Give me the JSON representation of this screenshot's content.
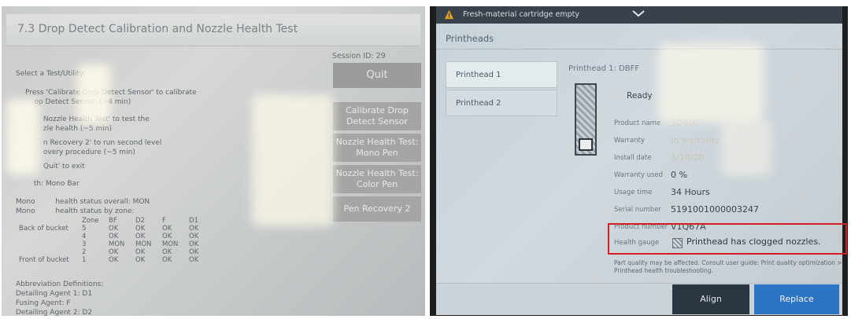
{
  "left": {
    "title": "7.3 Drop Detect Calibration and Nozzle Health Test",
    "session": "Session ID: 29",
    "select_label": "Select a Test/Utility:",
    "instructions": [
      "Press 'Calibrate Drop Detect Sensor' to calibrate",
      "    op Detect Sensor. (~4 min)",
      "        Nozzle Health Test' to test the",
      "        zle health (~5 min)",
      "        n Recovery 2' to run second level",
      "        overy procedure (~5 min)",
      "        Quit' to exit",
      "        th: Mono Bar"
    ],
    "mono_overall": "Mono         health status overall: MON",
    "mono_by_zone": "Mono         health status by zone:",
    "buttons": {
      "quit": "Quit",
      "calibrate": "Calibrate Drop Detect Sensor",
      "nozzle_mono": "Nozzle Health Test: Mono Pen",
      "nozzle_color": "Nozzle Health Test: Color Pen",
      "pen_recovery": "Pen Recovery 2"
    },
    "zone_table": {
      "headers": [
        "",
        "Zone",
        "BF",
        "D2",
        "F",
        "D1"
      ],
      "rows": [
        [
          "Back of bucket",
          "5",
          "OK",
          "OK",
          "OK",
          "OK"
        ],
        [
          "",
          "4",
          "OK",
          "OK",
          "OK",
          "OK"
        ],
        [
          "",
          "3",
          "MON",
          "MON",
          "MON",
          "OK"
        ],
        [
          "",
          "2",
          "OK",
          "OK",
          "OK",
          "OK"
        ],
        [
          "Front of bucket",
          "1",
          "OK",
          "OK",
          "OK",
          "OK"
        ]
      ]
    },
    "abbrev_title": "Abbreviation Definitions:",
    "abbrevs": [
      "Detailing Agent 1: D1",
      "Fusing Agent: F",
      "Detailing Agent 2: D2"
    ]
  },
  "right": {
    "notification": "Fresh-material cartridge empty",
    "page_title": "Printheads",
    "list": [
      "Printhead 1",
      "Printhead 2"
    ],
    "detail_title": "Printhead 1: DBFF",
    "status": "Ready",
    "properties": [
      {
        "label": "Product name",
        "value": "3D400"
      },
      {
        "label": "Warranty",
        "value": "In warranty"
      },
      {
        "label": "Install date",
        "value": "3/10/20"
      },
      {
        "label": "Warranty used",
        "value": "0 %"
      },
      {
        "label": "Usage time",
        "value": "34 Hours"
      },
      {
        "label": "Serial number",
        "value": "5191001000003247"
      },
      {
        "label": "Product number",
        "value": "V1Q67A"
      }
    ],
    "health_label": "Health gauge",
    "health_text": "Printhead has clogged nozzles.",
    "note": "Part quality may be affected. Consult user guide: Print quality optimization > Printhead health troubleshooting.",
    "buttons": {
      "align": "Align",
      "replace": "Replace"
    }
  },
  "colors": {
    "highlight": "#d21f24",
    "primary_button": "#2d74c4",
    "dark_button": "#2a3542"
  }
}
